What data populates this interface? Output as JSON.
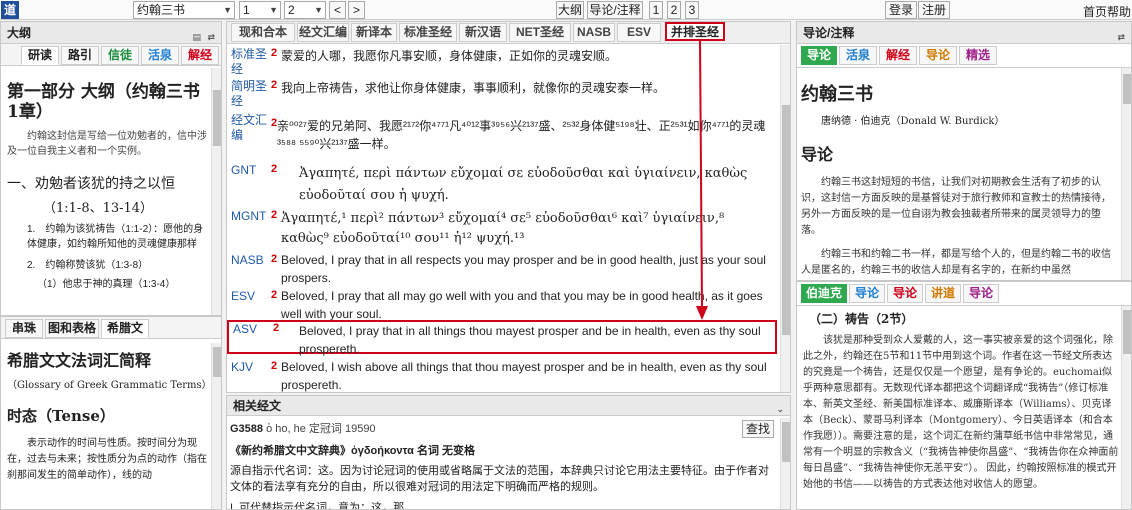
{
  "topbar": {
    "logo": "道",
    "book": "约翰三书",
    "chapter": "1",
    "verse": "2",
    "prev": "<",
    "next": ">",
    "outline_btn": "大纲",
    "guide_btn": "导论/注释",
    "page1": "1",
    "page2": "2",
    "page3": "3",
    "login": "登录",
    "register": "注册",
    "home": "首页",
    "help": "帮助"
  },
  "left": {
    "title": "大纲",
    "tabs": [
      "研读",
      "路引",
      "信徒",
      "活泉",
      "解经"
    ],
    "heading": "第一部分 大纲（约翰三书1章）",
    "intro": "约翰这封信是写给一位劝勉者的，信中涉及一位自我主义者和一个实例。",
    "section1": "一、劝勉者该犹的持之以恒",
    "section1_ref": "（1:1-8、13-14）",
    "item1": "1.　约翰为该犹祷告（1:1-2）：愿他的身体健康，如约翰所知他的灵魂健康那样",
    "item2": "2.　约翰称赞该犹（1:3-8）",
    "item2_sub": "（1）他忠于神的真理（1:3-4）"
  },
  "left2": {
    "tabs": [
      "串珠",
      "图和表格",
      "希腊文"
    ],
    "heading": "希腊文文法词汇简释",
    "subheading": "（Glossary of Greek Grammatic Terms）",
    "section": "时态（Tense）",
    "text": "表示动作的时间与性质。按时间分为现在，过去与未来；按性质分为点的动作（指在刹那间发生的简单动作），线的动"
  },
  "center": {
    "tabs": [
      "现和合本",
      "经文汇编",
      "新译本",
      "标准圣经",
      "新汉语",
      "NET圣经",
      "NASB",
      "ESV",
      "并排圣经"
    ],
    "verses": [
      {
        "label": "标准圣经",
        "num": "2",
        "text": "蒙爱的人哪，我愿你凡事安顺，身体健康，正如你的灵魂安顺。"
      },
      {
        "label": "简明圣经",
        "num": "2",
        "text": "我向上帝祷告，求他让你身体健康，事事顺利，就像你的灵魂安泰一样。"
      },
      {
        "label": "经文汇编",
        "num": "2",
        "text": "亲⁰⁰²⁷爱的兄弟阿、我愿²¹⁷²你⁴⁷⁷¹凡⁴⁰¹²事³⁹⁵⁶兴²¹³⁷盛、²⁵³²身体健⁵¹⁹⁸壮、正²⁵³¹如你⁴⁷⁷¹的灵魂³⁵⁸⁸ ⁵⁵⁹⁰兴²¹³⁷盛一样。"
      },
      {
        "label": "GNT",
        "num": "2",
        "text": "Ἀγαπητέ, περὶ πάντων εὔχομαί σε εὐοδοῦσθαι καὶ ὑγιαίνειν, καθὼς εὐοδοῦταί σου ἡ ψυχή."
      },
      {
        "label": "MGNT",
        "num": "2",
        "text": "Ἀγαπητέ,¹ περὶ² πάντων³ εὔχομαί⁴ σε⁵ εὐοδοῦσθαι⁶ καὶ⁷ ὑγιαίνειν,⁸ καθὼς⁹ εὐοδοῦταί¹⁰ σου¹¹ ἡ¹² ψυχή.¹³"
      },
      {
        "label": "NASB",
        "num": "2",
        "text": "Beloved, I pray that in all respects you may prosper and be in good health, just as your soul prospers."
      },
      {
        "label": "ESV",
        "num": "2",
        "text": "Beloved, I pray that all may go well with you and that you may be in good health, as it goes well with your soul."
      },
      {
        "label": "ASV",
        "num": "2",
        "text": "Beloved, I pray that in all things thou mayest prosper and be in health, even as thy soul prospereth."
      },
      {
        "label": "KJV",
        "num": "2",
        "text": "Beloved, I wish above all things that thou mayest prosper and be in health, even as thy soul prospereth."
      }
    ],
    "related_title": "相关经文",
    "strong": "G3588",
    "strong_rest": "ὁ ho, he 定冠词 19590",
    "search_btn": "查找",
    "dict_line": "《新约希腊文中文辞典》ὀγδοήκοντα 名词 无变格",
    "dict_text": "源自指示代名词：这。因为讨论冠词的使用或省略属于文法的范围，本辞典只讨论它用法主要特征。由于作者对文体的看法享有充分的自由，所以很难对冠词的用法定下明确而严格的规则。",
    "dict_last": "I. 可代替指示代名词，意为：这，那"
  },
  "right": {
    "title": "导论/注释",
    "tabs": [
      "导论",
      "活泉",
      "解经",
      "导论",
      "精选"
    ],
    "book_title": "约翰三书",
    "author": "唐纳德 · 伯迪克（Donald W. Burdick）",
    "section": "导论",
    "para1": "约翰三书这封短短的书信，让我们对初期教会生活有了初步的认识，这封信一方面反映的是基督徒对于旅行教师和宣教士的热情接待，另外一方面反映的是一位自诩为教会独裁者所带来的属灵领导力的堕落。",
    "para2": "约翰三书和约翰二书一样，都是写给个人的，但是约翰二书的收信人是匿名的，约翰三书的收信人却是有名字的，在新约中虽然"
  },
  "right2": {
    "tabs": [
      "伯迪克",
      "导论",
      "导论",
      "讲道",
      "导论"
    ],
    "heading": "（二）祷告（2节）",
    "text": "该犹是那种受到众人爱戴的人，这一事实被亲爱的这个词强化，除此之外，约翰还在5节和11节中用到这个词。作者在这一节经文所表达的究竟是一个祷告，还是仅仅是一个愿望，是有争论的。euchomai似乎两种意思都有。无数现代译本都把这个词翻译成“我祷告”（修订标准本、新英文圣经、新美国标准译本、威廉斯译本（Williams）、贝克译本（Beck）、蒙哥马利译本（Montgomery）、今日英语译本（和合本作我愿））。需要注意的是，这个词汇在新约蒲草纸书信中非常常见，通常有一个明显的宗教含义（“我祷告神使你昌盛”、“我祷告你在众神面前每日昌盛”、“我祷告神使你无恙平安”）。 因此，约翰按照标准的模式开始他的书信——以祷告的方式表达他对收信人的愿望。"
  },
  "colors": {
    "accent_blue": "#1f4e9a",
    "highlight_red": "#d0021b",
    "link_blue": "#1f5aa6",
    "tab_green": "#1c8c3c"
  }
}
